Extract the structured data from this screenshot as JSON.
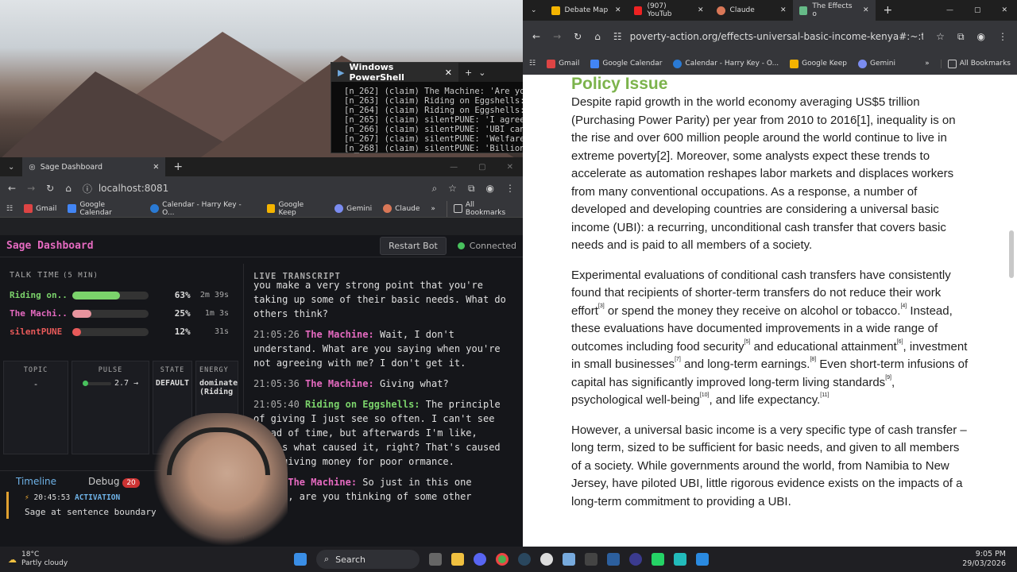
{
  "powershell": {
    "tab_title": "Windows PowerShell",
    "lines": [
      "[n_262] (claim) The Machine: 'Are you",
      "[n_263] (claim) Riding on Eggshells:",
      "[n_264] (claim) Riding on Eggshells:",
      "[n_265] (claim) silentPUNE: 'I agree",
      "[n_266] (claim) silentPUNE: 'UBI can b",
      "[n_267] (claim) silentPUNE: 'Welfare a",
      "[n_268] (claim) silentPUNE: 'Billiona"
    ]
  },
  "left_browser": {
    "tab_title": "Sage Dashboard",
    "url": "localhost:8081",
    "bookmarks": [
      "Gmail",
      "Google Calendar",
      "Calendar - Harry Key - O...",
      "Google Keep",
      "Gemini",
      "Claude"
    ],
    "all_bookmarks": "All Bookmarks"
  },
  "sage": {
    "title": "Sage Dashboard",
    "restart_label": "Restart Bot",
    "status": "Connected",
    "talk_time_label": "TALK TIME",
    "talk_time_window": "(5 MIN)",
    "speakers": [
      {
        "name": "Riding on...",
        "pct": "63%",
        "time": "2m 39s",
        "fill": 0.63,
        "color": "#7bd36b",
        "name_color": "#7bd36b"
      },
      {
        "name": "The Machi...",
        "pct": "25%",
        "time": "1m 3s",
        "fill": 0.25,
        "color": "#e8949e",
        "name_color": "#e56ac0"
      },
      {
        "name": "silentPUNE",
        "pct": "12%",
        "time": "31s",
        "fill": 0.12,
        "color": "#e85a5a",
        "name_color": "#e85a5a"
      }
    ],
    "stats": {
      "topic_label": "TOPIC",
      "topic_value": "-",
      "pulse_label": "PULSE",
      "pulse_value": "2.7 →",
      "state_label": "STATE",
      "state_value": "DEFAULT",
      "energy_label": "ENERGY",
      "energy_value": "dominate",
      "energy_sub": "(Riding"
    },
    "timeline_tab": "Timeline",
    "debug_tab": "Debug",
    "debug_count": "20",
    "event_time": "20:45:53",
    "event_type": "ACTIVATION",
    "event_text": "Sage at sentence boundary",
    "transcript_label": "LIVE TRANSCRIPT",
    "transcript": [
      {
        "ts": "",
        "speaker": "",
        "text": "you make a very strong point that you're taking up some of their basic needs. What do others think?"
      },
      {
        "ts": "21:05:26",
        "speaker": "The Machine:",
        "color": "#e56ac0",
        "text": "Wait, I don't understand. What are you saying when you're not agreeing with me? I don't get it."
      },
      {
        "ts": "21:05:36",
        "speaker": "The Machine:",
        "color": "#e56ac0",
        "text": "Giving what?"
      },
      {
        "ts": "21:05:40",
        "speaker": "Riding on Eggshells:",
        "color": "#7bd36b",
        "text": "The principle of giving I just see so often. I can't see ahead of time, but afterwards I'm like, that's what caused it, right? That's caused just giving money for poor ormance."
      },
      {
        "ts": "05:41",
        "speaker": "The Machine:",
        "color": "#e56ac0",
        "text": "So just in this one stance, are you thinking of some other"
      }
    ]
  },
  "right_browser": {
    "tabs": [
      "Debate Map",
      "(907) YouTub",
      "Claude",
      "The Effects o"
    ],
    "url": "poverty-action.org/effects-universal-basic-income-kenya#:~:t...",
    "bookmarks": [
      "Gmail",
      "Google Calendar",
      "Calendar - Harry Key - O...",
      "Google Keep",
      "Gemini"
    ],
    "all_bookmarks": "All Bookmarks"
  },
  "article": {
    "heading": "Policy Issue",
    "p1": "Despite rapid growth in the world economy averaging US$5 trillion (Purchasing Power Parity) per year from 2010 to 2016[1], inequality is on the rise and over 600 million people around the world continue to live in extreme poverty[2]. Moreover, some analysts expect these trends to accelerate as automation reshapes labor markets and displaces workers from many conventional occupations. As a response, a number of developed and developing countries are considering a universal basic income (UBI): a recurring, unconditional cash transfer that covers basic needs and is paid to all members of a society.",
    "p2a": "Experimental evaluations of conditional cash transfers have consistently found that recipients of shorter-term transfers do not reduce their work effort",
    "s3": "[3]",
    "p2b": " or spend the money they receive on alcohol or tobacco.",
    "s4": "[4]",
    "p2c": " Instead, these evaluations have documented improvements in a wide range of outcomes including food security",
    "s5": "[5]",
    "p2d": " and educational attainment",
    "s6": "[6]",
    "p2e": ", investment in small businesses",
    "s7": "[7]",
    "p2f": " and long-term earnings.",
    "s8": "[8]",
    "p2g": " Even short-term infusions of capital has significantly improved long-term living standards",
    "s9": "[9]",
    "p2h": ", psychological well-being",
    "s10": "[10]",
    "p2i": ", and life expectancy.",
    "s11": "[11]",
    "p3": "However, a universal basic income is a very specific type of cash transfer – long term, sized to be sufficient for basic needs, and given to all members of a society. While governments around the world, from Namibia to New Jersey, have piloted UBI, little rigorous evidence exists on the impacts of a long-term commitment to providing a UBI."
  },
  "taskbar": {
    "weather_temp": "18°C",
    "weather_desc": "Partly cloudy",
    "search_label": "Search",
    "time": "9:05 PM",
    "date": "29/03/2026"
  }
}
